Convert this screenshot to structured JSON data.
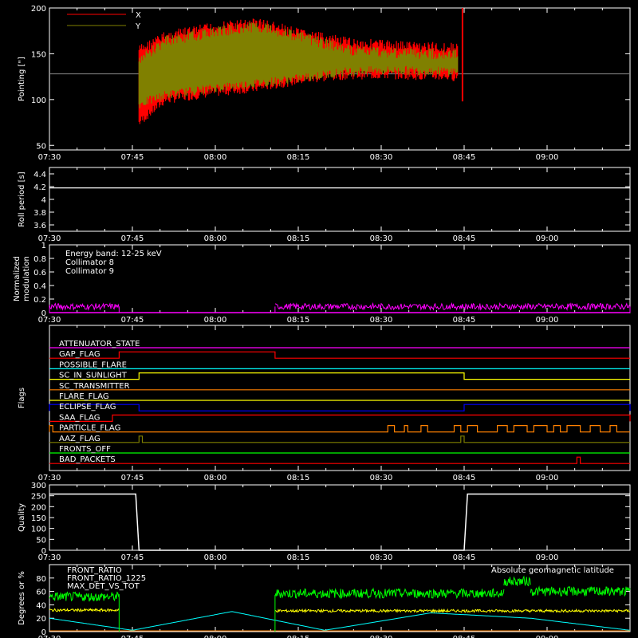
{
  "time_axis": {
    "ticks": [
      "07:30",
      "07:45",
      "08:00",
      "08:15",
      "08:30",
      "08:45",
      "09:00"
    ],
    "range_hours": [
      7.5,
      9.25
    ]
  },
  "colors": {
    "x": "#ff0000",
    "y": "#808000",
    "cyan": "#00ffff",
    "magenta": "#ff00ff",
    "white": "#ffffff",
    "red": "#ff0000",
    "orange": "#ff8000",
    "yellow": "#ffff00",
    "blue": "#0000ff",
    "green": "#00ff00",
    "olive": "#808000"
  },
  "chart_data": [
    {
      "id": "pointing",
      "type": "line",
      "ylabel": "Pointing [\"]",
      "ylim": [
        45,
        200
      ],
      "yticks": [
        50,
        100,
        150,
        200
      ],
      "legend": [
        "X",
        "Y"
      ],
      "reference_line": 128,
      "series": [
        {
          "name": "X",
          "color": "#ff0000",
          "upper": [
            [
              7.77,
              160
            ],
            [
              7.85,
              175
            ],
            [
              8.0,
              185
            ],
            [
              8.13,
              190
            ],
            [
              8.25,
              178
            ],
            [
              8.4,
              168
            ],
            [
              8.55,
              165
            ],
            [
              8.73,
              162
            ]
          ],
          "lower": [
            [
              7.77,
              70
            ],
            [
              7.85,
              95
            ],
            [
              8.0,
              103
            ],
            [
              8.13,
              108
            ],
            [
              8.25,
              116
            ],
            [
              8.4,
              122
            ],
            [
              8.55,
              122
            ],
            [
              8.73,
              120
            ]
          ]
        },
        {
          "name": "Y",
          "color": "#808000",
          "upper": [
            [
              7.77,
              148
            ],
            [
              7.85,
              170
            ],
            [
              8.0,
              180
            ],
            [
              8.13,
              186
            ],
            [
              8.25,
              175
            ],
            [
              8.4,
              160
            ],
            [
              8.55,
              157
            ],
            [
              8.73,
              155
            ]
          ],
          "lower": [
            [
              7.77,
              90
            ],
            [
              7.85,
              100
            ],
            [
              8.0,
              108
            ],
            [
              8.13,
              113
            ],
            [
              8.25,
              118
            ],
            [
              8.4,
              126
            ],
            [
              8.55,
              127
            ],
            [
              8.73,
              126
            ]
          ]
        }
      ]
    },
    {
      "id": "roll",
      "type": "line",
      "ylabel": "Roll period [s]",
      "ylim": [
        3.5,
        4.5
      ],
      "yticks": [
        3.6,
        3.8,
        4.0,
        4.2,
        4.4
      ],
      "series": [
        {
          "name": "",
          "color": "#ffffff",
          "x": [
            7.5,
            9.25
          ],
          "y": [
            4.18,
            4.18
          ]
        }
      ]
    },
    {
      "id": "modulation",
      "type": "line",
      "ylabel": [
        "Normalized",
        "modulation"
      ],
      "ylim": [
        0,
        1.0
      ],
      "yticks": [
        0.0,
        0.2,
        0.4,
        0.6,
        0.8,
        1.0
      ],
      "legend": [
        "Energy band: 12-25 keV",
        "Collimator 8",
        "Collimator 9"
      ],
      "series": [
        {
          "name": "Collimator 8",
          "color": "#00ffff",
          "segments": []
        },
        {
          "name": "Collimator 9",
          "color": "#ff00ff",
          "segments": [
            {
              "x": [
                7.5,
                7.71
              ],
              "level": 0.09
            },
            {
              "x": [
                8.18,
                9.25
              ],
              "level": 0.09
            }
          ],
          "baseline": 0.0
        }
      ]
    },
    {
      "id": "flags",
      "type": "line",
      "ylabel": "Flags",
      "flags": [
        {
          "name": "ATTENUATOR_STATE",
          "color": "#ff00ff",
          "on": []
        },
        {
          "name": "GAP_FLAG",
          "color": "#ff0000",
          "on": [
            [
              7.71,
              8.18
            ]
          ]
        },
        {
          "name": "POSSIBLE_FLARE",
          "color": "#00ffff",
          "on": []
        },
        {
          "name": "SC_IN_SUNLIGHT",
          "color": "#ffff00",
          "on": [
            [
              7.77,
              8.75
            ]
          ]
        },
        {
          "name": "SC_TRANSMITTER",
          "color": "#ff8000",
          "on": []
        },
        {
          "name": "FLARE_FLAG",
          "color": "#ffff00",
          "on": []
        },
        {
          "name": "ECLIPSE_FLAG",
          "color": "#0000ff",
          "on": [
            [
              7.5,
              7.77
            ],
            [
              8.75,
              9.25
            ]
          ]
        },
        {
          "name": "SAA_FLAG",
          "color": "#ff0000",
          "on": [
            [
              7.69,
              9.25
            ]
          ]
        },
        {
          "name": "PARTICLE_FLAG",
          "color": "#ff8000",
          "on": [
            [
              7.5,
              7.51
            ],
            [
              8.52,
              8.54
            ],
            [
              8.57,
              8.58
            ],
            [
              8.62,
              8.64
            ],
            [
              8.72,
              8.74
            ],
            [
              8.76,
              8.79
            ],
            [
              8.85,
              8.88
            ],
            [
              8.9,
              8.94
            ],
            [
              8.96,
              9.0
            ],
            [
              9.02,
              9.04
            ],
            [
              9.06,
              9.1
            ],
            [
              9.13,
              9.16
            ],
            [
              9.19,
              9.21
            ]
          ]
        },
        {
          "name": "AAZ_FLAG",
          "color": "#808000",
          "on": [
            [
              7.77,
              7.78
            ],
            [
              8.74,
              8.75
            ]
          ]
        },
        {
          "name": "FRONTS_OFF",
          "color": "#00ff00",
          "on": []
        },
        {
          "name": "BAD_PACKETS",
          "color": "#ff0000",
          "on": [
            [
              9.09,
              9.1
            ]
          ]
        }
      ]
    },
    {
      "id": "quality",
      "type": "line",
      "ylabel": "Quality",
      "ylim": [
        0,
        300
      ],
      "yticks": [
        0,
        50,
        100,
        150,
        200,
        250,
        300
      ],
      "series": [
        {
          "name": "",
          "color": "#ffffff",
          "x": [
            7.5,
            7.76,
            7.77,
            8.75,
            8.76,
            9.25
          ],
          "y": [
            258,
            258,
            0,
            0,
            258,
            258
          ]
        }
      ]
    },
    {
      "id": "ratios",
      "type": "line",
      "ylabel": "Degrees or %",
      "ylim": [
        0,
        100
      ],
      "yticks": [
        0,
        20,
        40,
        60,
        80
      ],
      "legend": [
        "FRONT_RATIO",
        "FRONT_RATIO_1225",
        "MAX_DET_VS_TOT",
        "Absolute geomagnetic latitude"
      ],
      "series": [
        {
          "name": "FRONT_RATIO",
          "color": "#00ff00",
          "segments": [
            {
              "x": [
                7.5,
                7.71
              ],
              "level": 52
            },
            {
              "x": [
                8.18,
                8.87
              ],
              "level": 57
            },
            {
              "x": [
                8.87,
                8.95
              ],
              "level": 75
            },
            {
              "x": [
                8.95,
                9.25
              ],
              "level": 60
            }
          ]
        },
        {
          "name": "FRONT_RATIO_1225",
          "color": "#00ff00",
          "segments": []
        },
        {
          "name": "MAX_DET_VS_TOT",
          "color": "#ffff00",
          "segments": [
            {
              "x": [
                7.5,
                7.71
              ],
              "level": 32
            },
            {
              "x": [
                8.18,
                9.25
              ],
              "level": 31
            }
          ]
        },
        {
          "name": "Absolute geomagnetic latitude",
          "color": "#00ffff",
          "x": [
            7.5,
            7.75,
            8.05,
            8.33,
            8.65,
            8.95,
            9.25
          ],
          "y": [
            20,
            2,
            30,
            2,
            28,
            20,
            2
          ]
        }
      ]
    }
  ]
}
